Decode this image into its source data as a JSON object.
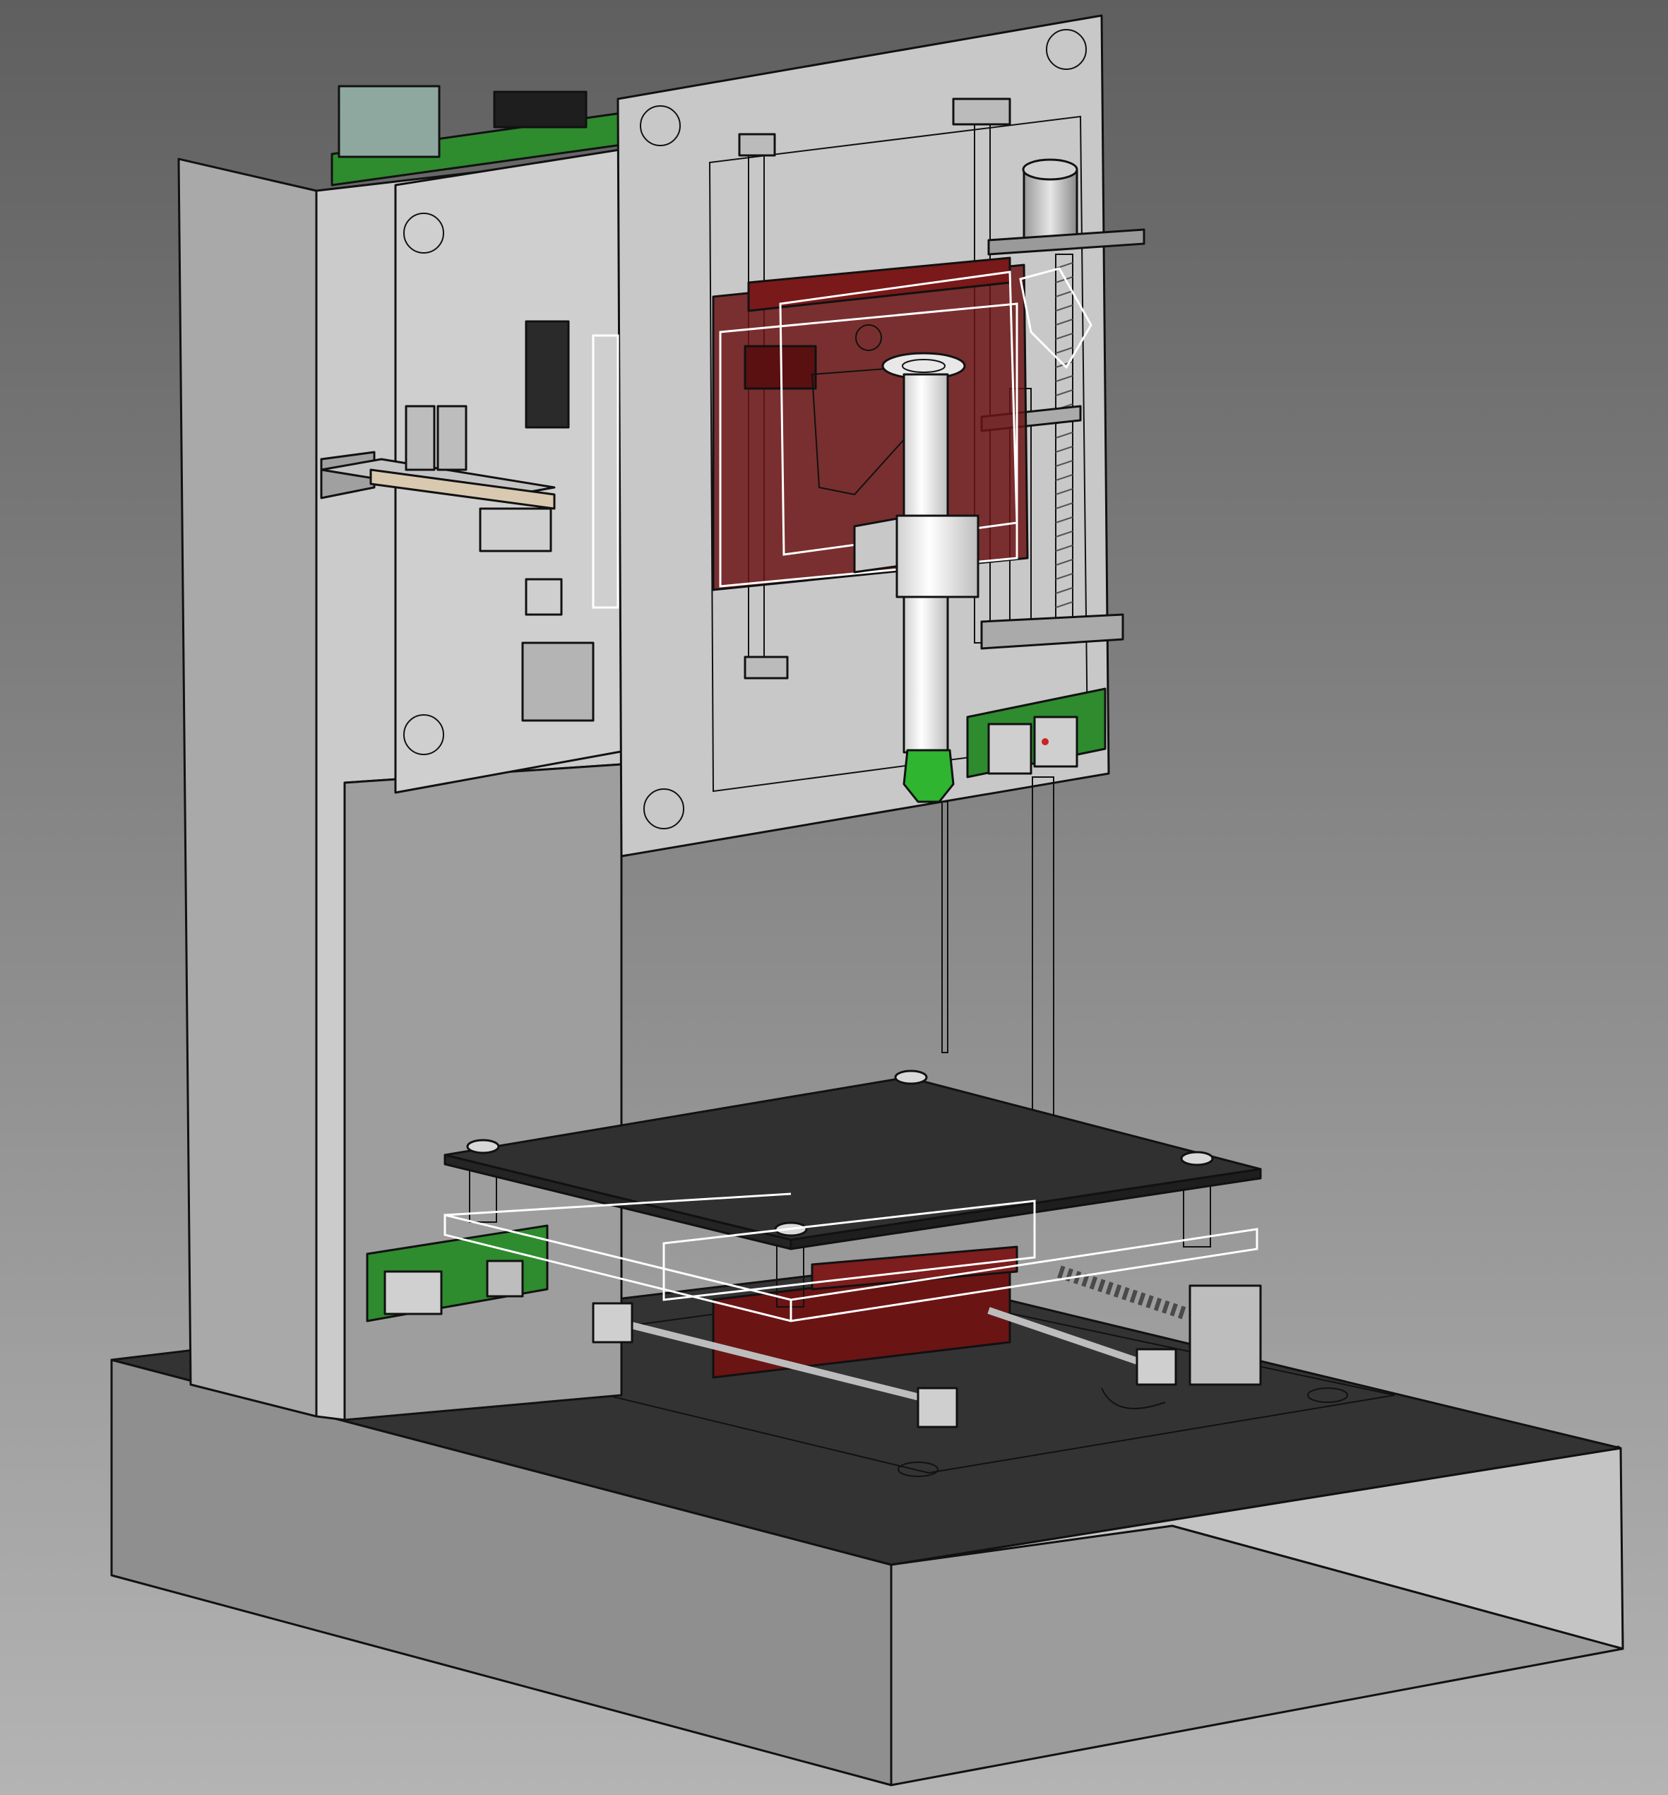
{
  "viewport": {
    "background_top": "#5f5f5f",
    "background_bottom": "#b4b4b4"
  },
  "colors": {
    "frame_light": "#c9c9c9",
    "frame_mid": "#a8a8a8",
    "frame_dark": "#8e8e8e",
    "base_top": "#333333",
    "pcb_green": "#2e8b2e",
    "carriage_red": "#6b1414",
    "syringe_white": "#f2f2f2",
    "needle_tip_green": "#2fb52f",
    "outline": "#111111",
    "selection_wireframe": "#ffffff"
  },
  "parts": [
    {
      "name": "base-plate",
      "material": "dark-sheet"
    },
    {
      "name": "frame-side-wall",
      "material": "grey-sheet"
    },
    {
      "name": "z-axis-plate",
      "material": "grey-sheet"
    },
    {
      "name": "carriage-plate",
      "material": "grey-sheet"
    },
    {
      "name": "control-board",
      "material": "pcb-green"
    },
    {
      "name": "stepper-motor",
      "material": "grey"
    },
    {
      "name": "lead-screw",
      "material": "grey"
    },
    {
      "name": "syringe",
      "material": "white"
    },
    {
      "name": "needle-tip",
      "material": "green"
    },
    {
      "name": "extruder-block",
      "material": "red-translucent"
    },
    {
      "name": "print-bed",
      "material": "dark-sheet"
    },
    {
      "name": "bed-springs",
      "material": "dark"
    },
    {
      "name": "y-carriage",
      "material": "red"
    },
    {
      "name": "endstop-board",
      "material": "pcb-green"
    }
  ]
}
